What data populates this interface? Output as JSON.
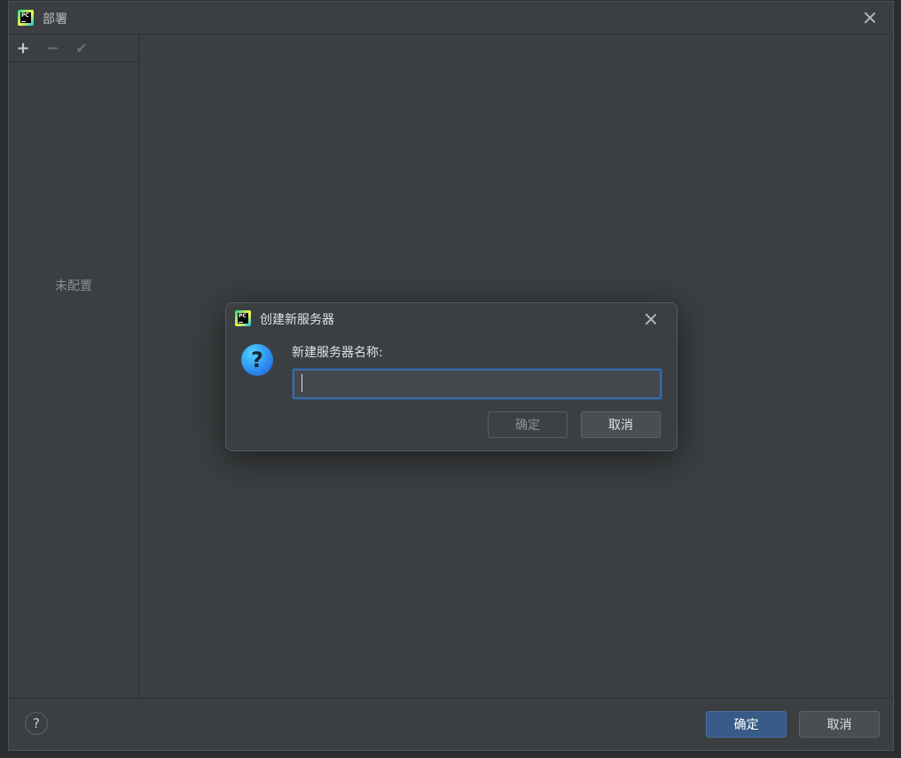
{
  "main_window": {
    "title": "部署",
    "toolbar": {
      "add_symbol": "+",
      "remove_symbol": "−",
      "apply_symbol": "✔"
    },
    "empty_text": "未配置",
    "help_symbol": "?",
    "ok_label": "确定",
    "cancel_label": "取消"
  },
  "modal": {
    "title": "创建新服务器",
    "field_label": "新建服务器名称:",
    "input_value": "",
    "question_symbol": "?",
    "ok_label": "确定",
    "cancel_label": "取消"
  },
  "colors": {
    "background": "#3c3f41",
    "primary_button": "#375a87",
    "focus_border": "#3d6aa3",
    "question_icon": "#2e8ff0"
  },
  "icons": {
    "app": "pycharm-logo-icon",
    "close": "close-icon",
    "add": "plus-icon",
    "remove": "minus-icon",
    "apply": "checkmark-icon",
    "help": "help-icon",
    "question": "question-icon"
  }
}
